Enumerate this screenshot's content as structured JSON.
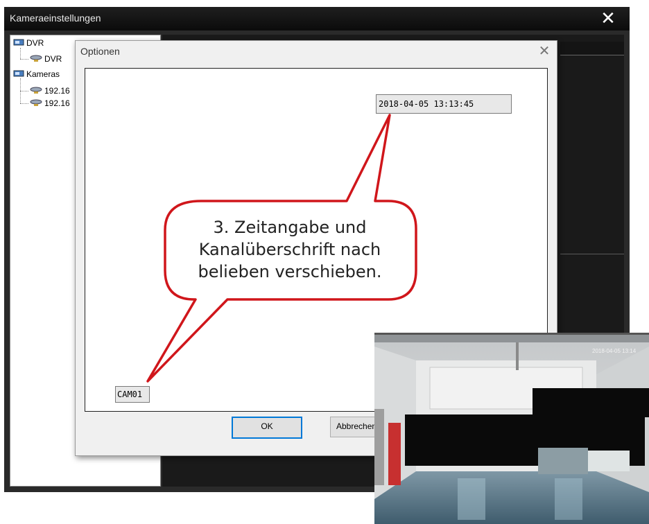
{
  "window": {
    "title": "Kameraeinstellungen",
    "close_glyph": "✕"
  },
  "tree": {
    "groups": [
      {
        "label": "DVR",
        "children": [
          "DVR"
        ]
      },
      {
        "label": "Kameras",
        "children": [
          "192.16",
          "192.16"
        ]
      }
    ]
  },
  "dialog": {
    "title": "Optionen",
    "close_glyph": "✕",
    "timestamp_value": "2018-04-05 13:13:45",
    "channel_value": "CAM01",
    "ok_label": "OK",
    "cancel_label": "Abbrechen"
  },
  "callout": {
    "line1": "3. Zeitangabe und",
    "line2": "Kanalüberschrift nach",
    "line3": "belieben verschieben.",
    "color": "#d0161b"
  },
  "photo": {
    "timestamp": "2018-04-05 13:14"
  },
  "colors": {
    "window_bg": "#2a2a2a",
    "dialog_bg": "#f0f0f0",
    "ok_border": "#0078d7"
  }
}
